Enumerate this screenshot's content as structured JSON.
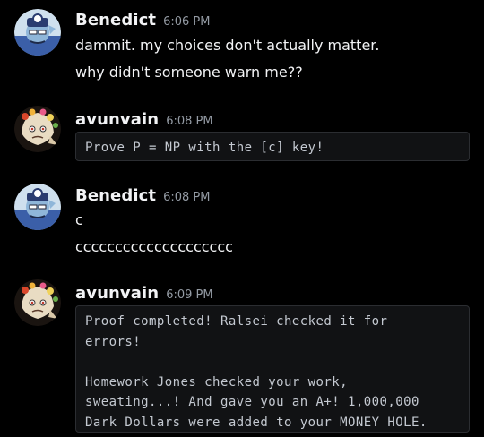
{
  "messages": [
    {
      "username": "Benedict",
      "timestamp": "6:06 PM",
      "lines": [
        "dammit. my choices don't actually matter.",
        "why didn't someone warn me??"
      ]
    },
    {
      "username": "avunvain",
      "timestamp": "6:08 PM",
      "code": "Prove P = NP with the [c] key!"
    },
    {
      "username": "Benedict",
      "timestamp": "6:08 PM",
      "lines": [
        "c",
        "cccccccccccccccccccc"
      ]
    },
    {
      "username": "avunvain",
      "timestamp": "6:09 PM",
      "code": "Proof completed! Ralsei checked it for\nerrors!\n\nHomework Jones checked your work,\nsweating...! And gave you an A+! 1,000,000\nDark Dollars were added to your MONEY HOLE."
    }
  ],
  "colors": {
    "background": "#000000",
    "username": "#f2f3f5",
    "timestamp": "#949ba4",
    "code_bg": "#111214"
  },
  "icons": {
    "benedict_avatar": "benedict-avatar-icon",
    "avunvain_avatar": "avunvain-avatar-icon"
  }
}
